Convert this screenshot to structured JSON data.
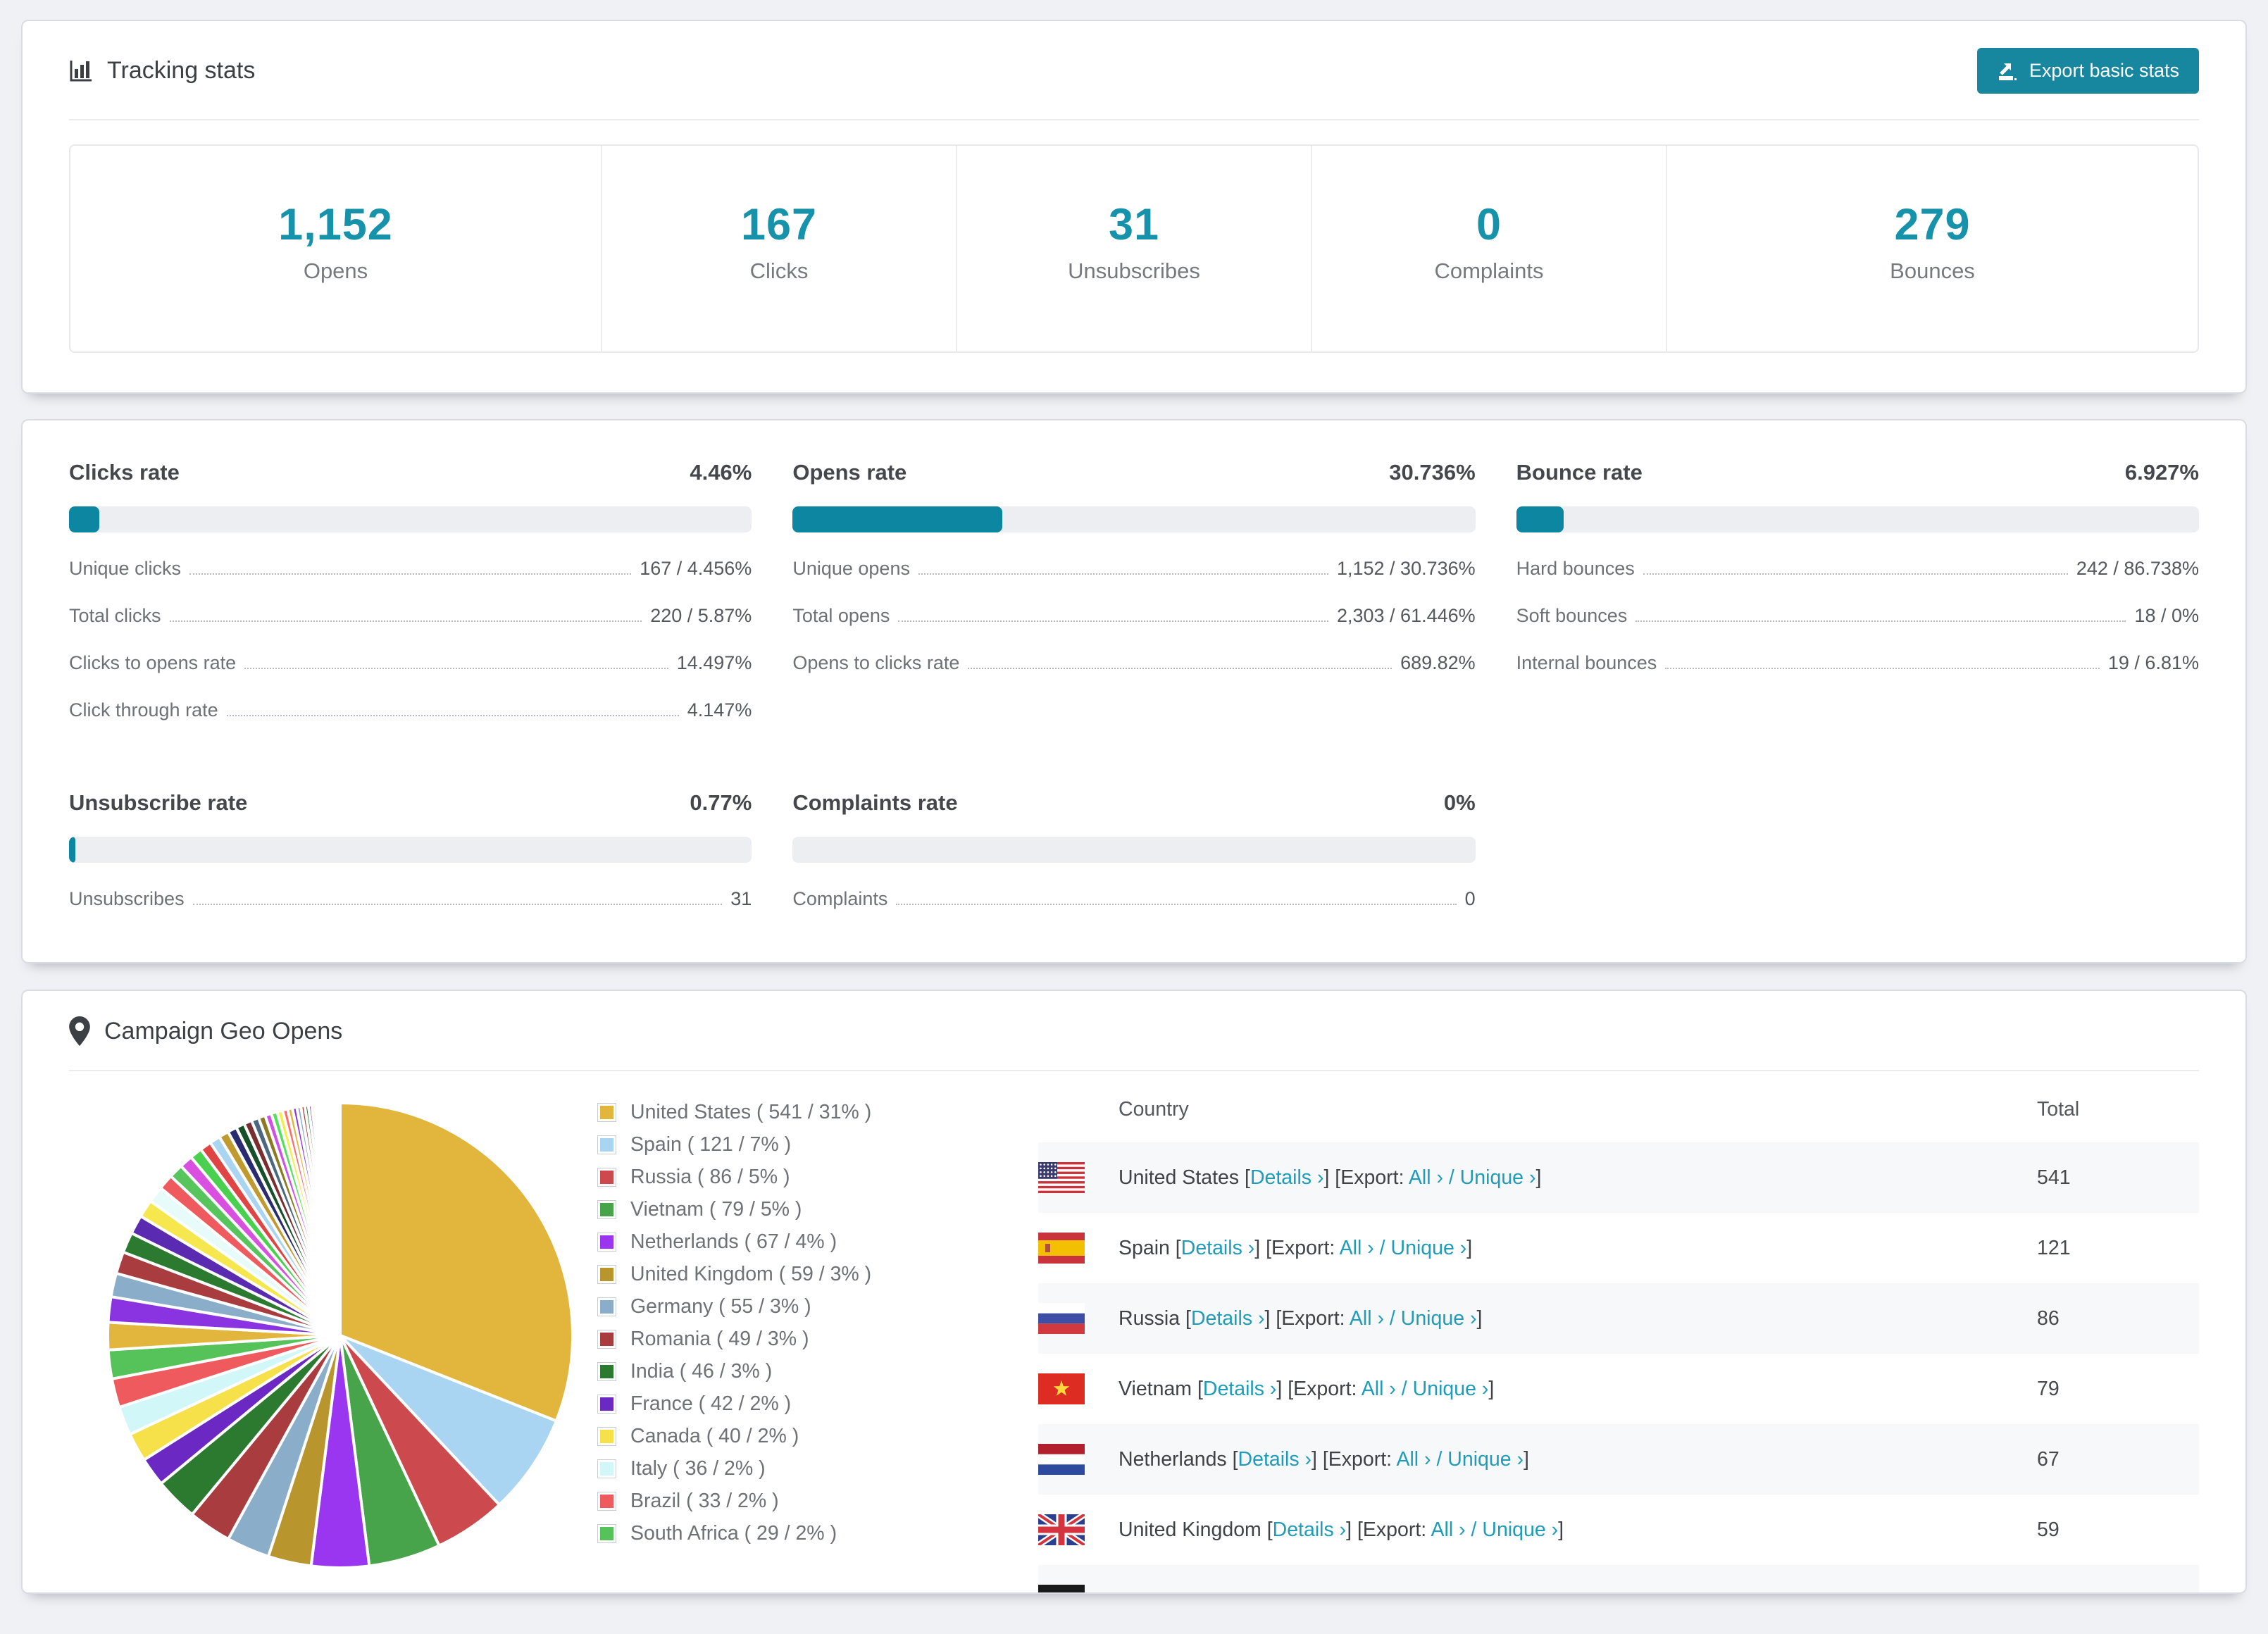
{
  "colors": {
    "accent": "#1792ab",
    "button": "#17879f",
    "bar_fill": "#0d87a1",
    "bar_track": "#eceef1",
    "link": "#1e9cb9"
  },
  "tracking": {
    "title": "Tracking stats",
    "export_button": "Export basic stats",
    "stats": [
      {
        "value": "1,152",
        "label": "Opens"
      },
      {
        "value": "167",
        "label": "Clicks"
      },
      {
        "value": "31",
        "label": "Unsubscribes"
      },
      {
        "value": "0",
        "label": "Complaints"
      },
      {
        "value": "279",
        "label": "Bounces"
      }
    ]
  },
  "rates": {
    "panels": [
      {
        "title": "Clicks rate",
        "value": "4.46%",
        "percent": 4.46,
        "rows": [
          {
            "label": "Unique clicks",
            "value": "167 / 4.456%"
          },
          {
            "label": "Total clicks",
            "value": "220 / 5.87%"
          },
          {
            "label": "Clicks to opens rate",
            "value": "14.497%"
          },
          {
            "label": "Click through rate",
            "value": "4.147%"
          }
        ]
      },
      {
        "title": "Opens rate",
        "value": "30.736%",
        "percent": 30.736,
        "rows": [
          {
            "label": "Unique opens",
            "value": "1,152 / 30.736%"
          },
          {
            "label": "Total opens",
            "value": "2,303 / 61.446%"
          },
          {
            "label": "Opens to clicks rate",
            "value": "689.82%"
          }
        ]
      },
      {
        "title": "Bounce rate",
        "value": "6.927%",
        "percent": 6.927,
        "rows": [
          {
            "label": "Hard bounces",
            "value": "242 / 86.738%"
          },
          {
            "label": "Soft bounces",
            "value": "18 / 0%"
          },
          {
            "label": "Internal bounces",
            "value": "19 / 6.81%"
          }
        ]
      },
      {
        "title": "Unsubscribe rate",
        "value": "0.77%",
        "percent": 0.77,
        "rows": [
          {
            "label": "Unsubscribes",
            "value": "31"
          }
        ]
      },
      {
        "title": "Complaints rate",
        "value": "0%",
        "percent": 0,
        "rows": [
          {
            "label": "Complaints",
            "value": "0"
          }
        ]
      }
    ]
  },
  "geo": {
    "title": "Campaign Geo Opens",
    "table": {
      "headers": {
        "country": "Country",
        "total": "Total"
      },
      "link_labels": {
        "details": "Details",
        "export": "Export:",
        "all": "All",
        "unique": "Unique",
        "chevron": "›"
      },
      "rows": [
        {
          "country": "United States",
          "flag": "us",
          "total": "541"
        },
        {
          "country": "Spain",
          "flag": "es",
          "total": "121"
        },
        {
          "country": "Russia",
          "flag": "ru",
          "total": "86"
        },
        {
          "country": "Vietnam",
          "flag": "vn",
          "total": "79"
        },
        {
          "country": "Netherlands",
          "flag": "nl",
          "total": "67"
        },
        {
          "country": "United Kingdom",
          "flag": "gb",
          "total": "59"
        }
      ],
      "partial_row": {
        "flag": "de"
      }
    }
  },
  "chart_data": {
    "type": "pie",
    "title": "Campaign Geo Opens",
    "unit": "opens",
    "start_angle_deg": 0,
    "direction": "clockwise",
    "legend_position": "right",
    "slices": [
      {
        "label": "United States",
        "value": 541,
        "percent": 31,
        "color": "#e2b63d"
      },
      {
        "label": "Spain",
        "value": 121,
        "percent": 7,
        "color": "#a9d5f2"
      },
      {
        "label": "Russia",
        "value": 86,
        "percent": 5,
        "color": "#cc4a4d"
      },
      {
        "label": "Vietnam",
        "value": 79,
        "percent": 5,
        "color": "#47a44b"
      },
      {
        "label": "Netherlands",
        "value": 67,
        "percent": 4,
        "color": "#9a36ef"
      },
      {
        "label": "United Kingdom",
        "value": 59,
        "percent": 3,
        "color": "#b8952d"
      },
      {
        "label": "Germany",
        "value": 55,
        "percent": 3,
        "color": "#8aadc9"
      },
      {
        "label": "Romania",
        "value": 49,
        "percent": 3,
        "color": "#a83c3e"
      },
      {
        "label": "India",
        "value": 46,
        "percent": 3,
        "color": "#2c7a30"
      },
      {
        "label": "France",
        "value": 42,
        "percent": 2,
        "color": "#6b28c2"
      },
      {
        "label": "Canada",
        "value": 40,
        "percent": 2,
        "color": "#f6e14a"
      },
      {
        "label": "Italy",
        "value": 36,
        "percent": 2,
        "color": "#d2f7f9"
      },
      {
        "label": "Brazil",
        "value": 33,
        "percent": 2,
        "color": "#ee5a5d"
      },
      {
        "label": "South Africa",
        "value": 29,
        "percent": 2,
        "color": "#55c25a"
      }
    ],
    "others_percent": 26
  }
}
